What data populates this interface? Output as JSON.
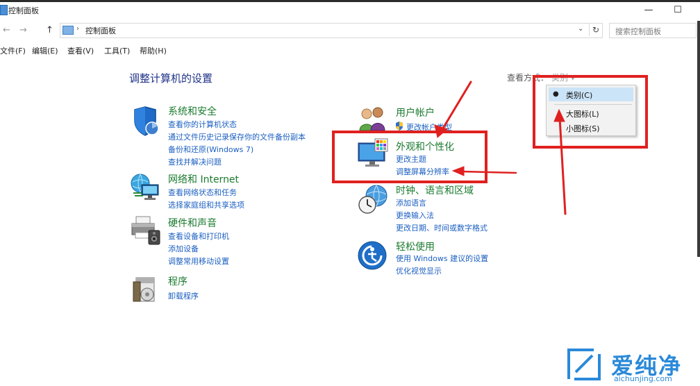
{
  "window": {
    "title": "控制面板",
    "minimize": "—",
    "maximize": "☐"
  },
  "address_bar": {
    "back": "←",
    "forward": "→",
    "up": "↑",
    "separator": "›",
    "path": "控制面板",
    "dropdown": "⌄",
    "refresh": "↻",
    "search_placeholder": "搜索控制面板"
  },
  "menu": [
    "文件(F)",
    "编辑(E)",
    "查看(V)",
    "工具(T)",
    "帮助(H)"
  ],
  "content": {
    "heading": "调整计算机的设置",
    "view_by_label": "查看方式：",
    "view_by_value": "类别 ▾"
  },
  "categories_left": [
    {
      "title": "系统和安全",
      "icon": "shield-icon",
      "links": [
        "查看你的计算机状态",
        "通过文件历史记录保存你的文件备份副本",
        "备份和还原(Windows 7)",
        "查找并解决问题"
      ]
    },
    {
      "title": "网络和 Internet",
      "icon": "globe-network-icon",
      "links": [
        "查看网络状态和任务",
        "选择家庭组和共享选项"
      ]
    },
    {
      "title": "硬件和声音",
      "icon": "printer-icon",
      "links": [
        "查看设备和打印机",
        "添加设备",
        "调整常用移动设置"
      ]
    },
    {
      "title": "程序",
      "icon": "programs-icon",
      "links": [
        "卸载程序"
      ]
    }
  ],
  "categories_right": [
    {
      "title": "用户帐户",
      "icon": "users-icon",
      "links": [
        "更改帐户类型"
      ]
    },
    {
      "title": "外观和个性化",
      "icon": "monitor-icon",
      "links": [
        "更改主题",
        "调整屏幕分辨率"
      ]
    },
    {
      "title": "时钟、语言和区域",
      "icon": "clock-globe-icon",
      "links": [
        "添加语言",
        "更换输入法",
        "更改日期、时间或数字格式"
      ]
    },
    {
      "title": "轻松使用",
      "icon": "ease-of-access-icon",
      "links": [
        "使用 Windows 建议的设置",
        "优化视觉显示"
      ]
    }
  ],
  "view_dropdown": {
    "items": [
      "类别(C)",
      "大图标(L)",
      "小图标(S)"
    ],
    "selected_index": 0
  },
  "watermark": {
    "text": "爱纯净",
    "url": "aichunjing.com"
  },
  "colors": {
    "category_title": "#1a7a2e",
    "link": "#1b5fc1",
    "heading": "#1e3287",
    "annotation": "#e02020",
    "watermark": "#2a89d8"
  }
}
